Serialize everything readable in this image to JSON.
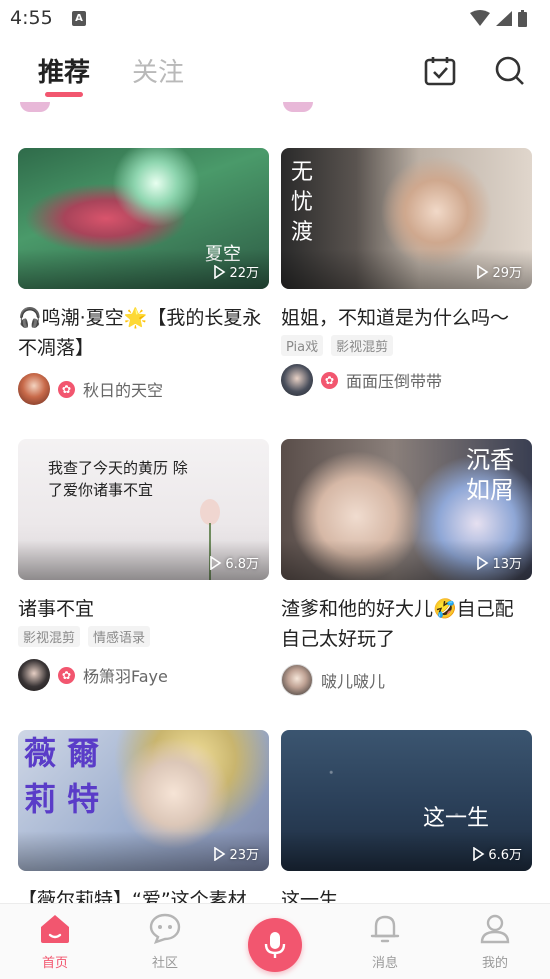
{
  "status_bar": {
    "time": "4:55",
    "notification_icon": "A"
  },
  "header": {
    "tabs": [
      {
        "label": "推荐",
        "active": true
      },
      {
        "label": "关注",
        "active": false
      }
    ],
    "icons": [
      "calendar-check-icon",
      "search-icon"
    ]
  },
  "feed": [
    {
      "title": "🎧鸣潮·夏空🌟【我的长夏永不凋落】",
      "thumb_text": "夏空",
      "plays": "22万",
      "tags": [],
      "author": "秋日的天空",
      "author_badge": true
    },
    {
      "title": "姐姐，不知道是为什么吗～",
      "thumb_text": "无忧渡",
      "plays": "29万",
      "tags": [
        "Pia戏",
        "影视混剪"
      ],
      "author": "面面压倒带带",
      "author_badge": true
    },
    {
      "title": "诸事不宜",
      "thumb_text": "我查了今天的黄历 除了爱你诸事不宜",
      "plays": "6.8万",
      "tags": [
        "影视混剪",
        "情感语录"
      ],
      "author": "杨箫羽Faye",
      "author_badge": true
    },
    {
      "title": "渣爹和他的好大儿🤣自己配自己太好玩了",
      "thumb_text": "沉香如屑",
      "plays": "13万",
      "tags": [],
      "author": "啵儿啵儿",
      "author_badge": false
    },
    {
      "title": "【薇尔莉特】“爱”这个素材",
      "thumb_text": "薇 爾 莉 特",
      "plays": "23万",
      "tags": [],
      "author": "",
      "author_badge": false
    },
    {
      "title": "这一生",
      "thumb_text": "这一生",
      "plays": "6.6万",
      "tags": [],
      "author": "",
      "author_badge": false
    }
  ],
  "bottom_nav": [
    {
      "label": "首页",
      "icon": "home-icon",
      "active": true
    },
    {
      "label": "社区",
      "icon": "chat-bubble-icon",
      "active": false
    },
    {
      "label": "",
      "icon": "microphone-icon",
      "active": false
    },
    {
      "label": "消息",
      "icon": "bell-icon",
      "active": false
    },
    {
      "label": "我的",
      "icon": "person-icon",
      "active": false
    }
  ],
  "colors": {
    "accent": "#f2566f",
    "inactive_text": "#b9b9b9"
  }
}
